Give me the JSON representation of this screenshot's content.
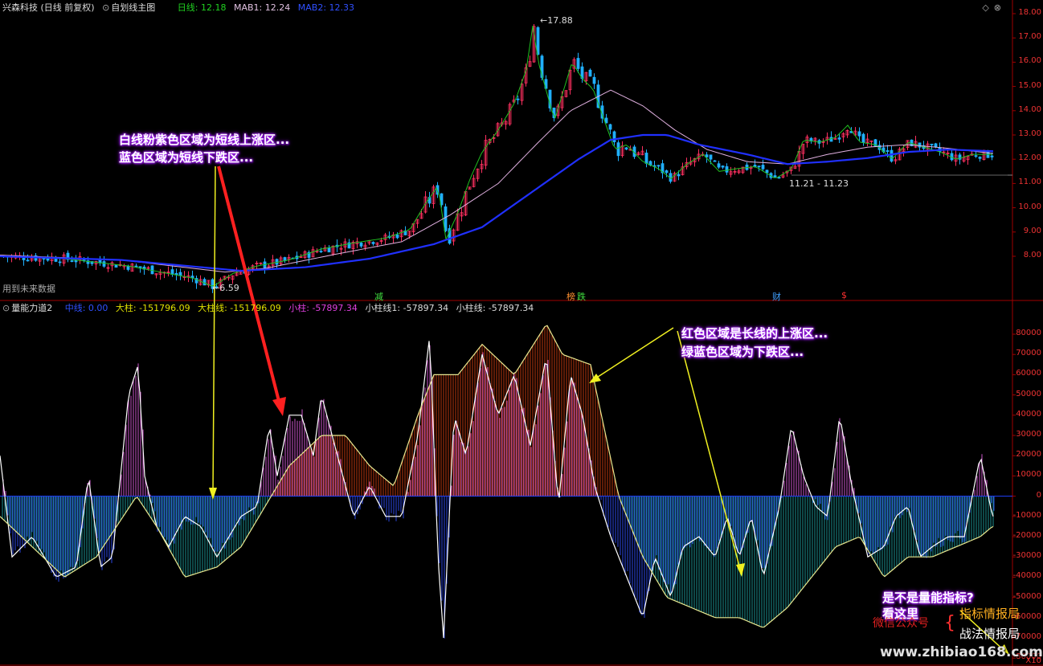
{
  "top_header": {
    "title": "兴森科技 (日线 前复权)",
    "formula": "自划线主图",
    "items": [
      {
        "label": "日线: 12.18",
        "color": "#20d020"
      },
      {
        "label": "MAB1: 12.24",
        "color": "#e0c0e0"
      },
      {
        "label": "MAB2: 12.33",
        "color": "#3050ff"
      }
    ]
  },
  "bottom_header": {
    "title": "量能力道2",
    "items": [
      {
        "label": "中线: 0.00",
        "color": "#3050ff"
      },
      {
        "label": "大柱: -151796.09",
        "color": "#e0e000"
      },
      {
        "label": "大柱线: -151796.09",
        "color": "#e0e000"
      },
      {
        "label": "小柱: -57897.34",
        "color": "#e040e0"
      },
      {
        "label": "小柱线1: -57897.34",
        "color": "#dddddd"
      },
      {
        "label": "小柱线: -57897.34",
        "color": "#dddddd"
      }
    ]
  },
  "price_axis": [
    "18.00",
    "17.00",
    "16.00",
    "15.00",
    "14.00",
    "13.00",
    "12.00",
    "11.00",
    "10.00",
    "9.00",
    "8.00"
  ],
  "volume_axis": [
    "80000",
    "70000",
    "60000",
    "50000",
    "40000",
    "30000",
    "20000",
    "10000",
    "0",
    "-10000",
    "-20000",
    "-30000",
    "-40000",
    "-50000",
    "-60000",
    "-70000",
    "-80000"
  ],
  "unit_label": "X10",
  "price_labels": {
    "high": "17.88",
    "low": "6.59",
    "range": "11.21 - 11.23"
  },
  "future_data_note": "用到未来数据",
  "events": [
    {
      "label": "减",
      "color": "#40e040"
    },
    {
      "label": "榜",
      "color": "#ff9030"
    },
    {
      "label": "跌",
      "color": "#40e040"
    },
    {
      "label": "财",
      "color": "#40a0ff"
    },
    {
      "label": "$",
      "color": "#ff3030"
    }
  ],
  "annotations": {
    "top_line1": "白线粉紫色区域为短线上涨区...",
    "top_line2": "蓝色区域为短线下跌区...",
    "bottom_line1": "红色区域是长线的上涨区...",
    "bottom_line2": "绿蓝色区域为下跌区...",
    "promo_line1": "是不是量能指标?",
    "promo_line2": "看这里",
    "wechat": "微信公众号",
    "brand1": "指标情报局",
    "brand2": "战法情报局",
    "site": "www.zhibiao168.com"
  },
  "colors": {
    "up": "#ff3060",
    "down": "#20b0ff",
    "ma_short": "#e0b0e0",
    "ma_long": "#2030ff",
    "grid": "#8a0000"
  }
}
